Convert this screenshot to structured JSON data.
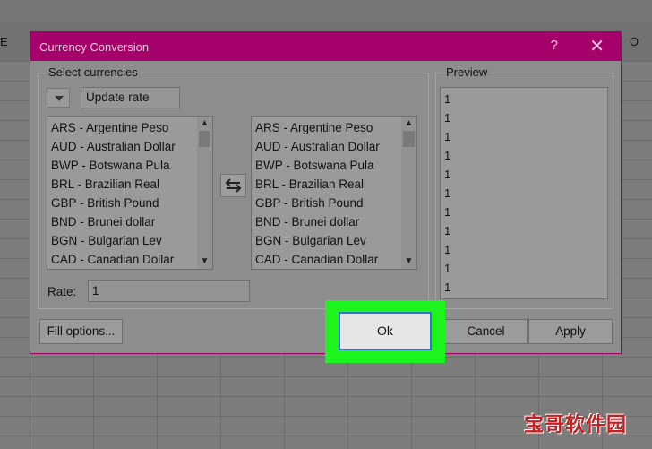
{
  "background": {
    "column_letters": [
      "E",
      "O"
    ]
  },
  "dialog": {
    "title": "Currency Conversion",
    "help_label": "?",
    "close_label": "✕",
    "select_group_title": "Select currencies",
    "update_rate_label": "Update rate",
    "from_list": [
      "ARS - Argentine Peso",
      "AUD - Australian Dollar",
      "BWP - Botswana Pula",
      "BRL - Brazilian Real",
      "GBP - British Pound",
      "BND - Brunei dollar",
      "BGN - Bulgarian Lev",
      "CAD - Canadian Dollar"
    ],
    "to_list": [
      "ARS - Argentine Peso",
      "AUD - Australian Dollar",
      "BWP - Botswana Pula",
      "BRL - Brazilian Real",
      "GBP - British Pound",
      "BND - Brunei dollar",
      "BGN - Bulgarian Lev",
      "CAD - Canadian Dollar"
    ],
    "rate_label": "Rate:",
    "rate_value": "1",
    "preview_title": "Preview",
    "preview_values": [
      "1",
      "1",
      "1",
      "1",
      "1",
      "1",
      "1",
      "1",
      "1",
      "1",
      "1"
    ],
    "fill_options_label": "Fill options...",
    "ok_label": "Ok",
    "cancel_label": "Cancel",
    "apply_label": "Apply"
  },
  "watermark": "宝哥软件园",
  "colors": {
    "titlebar": "#a6006a",
    "highlight": "#1df31d",
    "ok_border": "#2a78c9"
  }
}
